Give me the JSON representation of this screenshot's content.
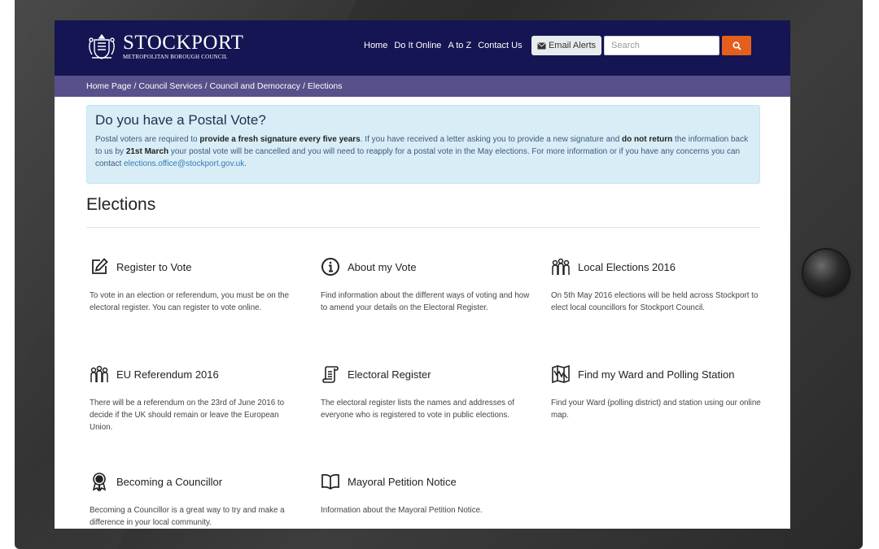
{
  "header": {
    "logo_name": "STOCKPORT",
    "logo_sub": "METROPOLITAN BOROUGH COUNCIL",
    "nav": [
      "Home",
      "Do It Online",
      "A to Z",
      "Contact Us"
    ],
    "email_alerts": "Email Alerts",
    "search_placeholder": "Search",
    "colors": {
      "header_bg": "#151553",
      "breadcrumb_bg": "#58508a",
      "search_button": "#e35f1b"
    }
  },
  "breadcrumb": [
    "Home Page",
    "Council Services",
    "Council and Democracy",
    "Elections"
  ],
  "alert": {
    "title": "Do you have a Postal Vote?",
    "t1": "Postal voters are required to ",
    "b1": "provide a fresh signature every five years",
    "t2": ". If you have received a letter asking you to provide a new signature and ",
    "b2": "do not return",
    "t3": " the information back to us by ",
    "b3": "21st March",
    "t4": " your postal vote will be cancelled and you will need to reapply for a postal vote in the May elections. For more information or if you have any concerns you can contact ",
    "email": "elections.office@stockport.gov.uk",
    "t5": "."
  },
  "page_title": "Elections",
  "cards": [
    {
      "icon": "edit-icon",
      "title": "Register to Vote",
      "desc": "To vote in an election or referendum, you must be on the electoral register. You can register to vote online."
    },
    {
      "icon": "info-icon",
      "title": "About my Vote",
      "desc": "Find information about the different ways of voting and how to amend your details on the Electoral Register."
    },
    {
      "icon": "people-icon",
      "title": "Local Elections 2016",
      "desc": "On 5th May 2016 elections will be held across Stockport to elect local councillors for Stockport Council."
    },
    {
      "icon": "people-icon",
      "title": "EU Referendum 2016",
      "desc": "There will be a referendum on the 23rd of June 2016 to decide if the UK should remain or leave the European Union."
    },
    {
      "icon": "scroll-icon",
      "title": "Electoral Register",
      "desc": "The electoral register lists the names and addresses of everyone who is registered to vote in public elections."
    },
    {
      "icon": "map-icon",
      "title": "Find my Ward and Polling Station",
      "desc": "Find your Ward (polling district) and station using our online map."
    },
    {
      "icon": "award-icon",
      "title": "Becoming a Councillor",
      "desc": "Becoming a Councillor is a great way to try and make a difference in your local community."
    },
    {
      "icon": "book-icon",
      "title": "Mayoral Petition Notice",
      "desc": "Information about the Mayoral Petition Notice."
    }
  ]
}
